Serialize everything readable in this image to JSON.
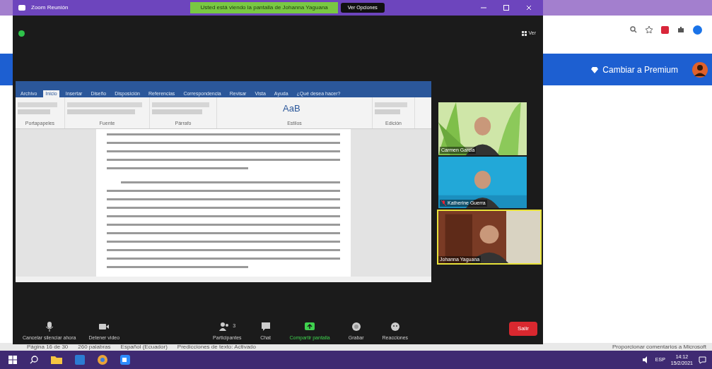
{
  "browser": {
    "premium_button": "Cambiar a Premium",
    "feedback_link": "Proporcionar comentarios a Microsoft"
  },
  "zoom_window": {
    "title": "Zoom Reunión",
    "share_banner": "Usted está viendo la pantalla de Johanna Yaguana",
    "view_options": "Ver Opciones",
    "view_button": "Ver",
    "shared_word": {
      "tabs": [
        {
          "label": "Archivo",
          "selected": false
        },
        {
          "label": "Inicio",
          "selected": true
        },
        {
          "label": "Insertar",
          "selected": false
        },
        {
          "label": "Diseño",
          "selected": false
        },
        {
          "label": "Disposición",
          "selected": false
        },
        {
          "label": "Referencias",
          "selected": false
        },
        {
          "label": "Correspondencia",
          "selected": false
        },
        {
          "label": "Revisar",
          "selected": false
        },
        {
          "label": "Vista",
          "selected": false
        },
        {
          "label": "Ayuda",
          "selected": false
        },
        {
          "label": "¿Qué desea hacer?",
          "selected": false
        }
      ],
      "ribbon_groups": [
        "Portapapeles",
        "Fuente",
        "Párrafo",
        "Estilos",
        "Edición"
      ],
      "style_sample": "AaB"
    },
    "participants": [
      {
        "name": "Carmen Garcia",
        "muted": false,
        "active_speaker": false
      },
      {
        "name": "Katherine Guerra",
        "muted": true,
        "active_speaker": false
      },
      {
        "name": "Johanna Yaguana",
        "muted": false,
        "active_speaker": true
      }
    ],
    "toolbar": [
      {
        "kind": "mic",
        "label": "Cancelar silenciar ahora"
      },
      {
        "kind": "video",
        "label": "Detener video"
      },
      {
        "kind": "participants",
        "label": "Participantes",
        "count": "3"
      },
      {
        "kind": "chat",
        "label": "Chat"
      },
      {
        "kind": "share",
        "label": "Compartir pantalla"
      },
      {
        "kind": "record",
        "label": "Grabar"
      },
      {
        "kind": "reactions",
        "label": "Reacciones"
      }
    ],
    "leave_button": "Salir"
  },
  "word_status_bar": [
    "Página 16 de 30",
    "260 palabras",
    "Español (Ecuador)",
    "Predicciones de texto: Activado"
  ],
  "taskbar": {
    "language": "ESP",
    "time": "14:12",
    "date": "15/2/2021"
  }
}
